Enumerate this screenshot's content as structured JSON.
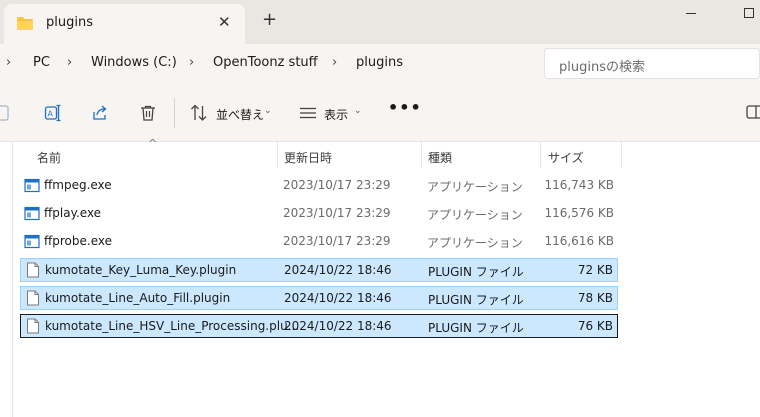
{
  "tab": {
    "title": "plugins",
    "close": "✕",
    "new_tab": "+"
  },
  "breadcrumb": {
    "items": [
      "PC",
      "Windows (C:)",
      "OpenToonz stuff",
      "plugins"
    ]
  },
  "search": {
    "placeholder": "pluginsの検索"
  },
  "toolbar": {
    "sort_label": "並べ替え",
    "view_label": "表示",
    "more": "•••"
  },
  "columns": {
    "name": "名前",
    "date": "更新日時",
    "type": "種類",
    "size": "サイズ"
  },
  "files": [
    {
      "name": "ffmpeg.exe",
      "date": "2023/10/17 23:29",
      "type": "アプリケーション",
      "size": "116,743 KB",
      "kind": "exe",
      "state": "normal"
    },
    {
      "name": "ffplay.exe",
      "date": "2023/10/17 23:29",
      "type": "アプリケーション",
      "size": "116,576 KB",
      "kind": "exe",
      "state": "normal"
    },
    {
      "name": "ffprobe.exe",
      "date": "2023/10/17 23:29",
      "type": "アプリケーション",
      "size": "116,616 KB",
      "kind": "exe",
      "state": "normal"
    },
    {
      "name": "kumotate_Key_Luma_Key.plugin",
      "date": "2024/10/22 18:46",
      "type": "PLUGIN ファイル",
      "size": "72 KB",
      "kind": "file",
      "state": "selected"
    },
    {
      "name": "kumotate_Line_Auto_Fill.plugin",
      "date": "2024/10/22 18:46",
      "type": "PLUGIN ファイル",
      "size": "78 KB",
      "kind": "file",
      "state": "selected"
    },
    {
      "name": "kumotate_Line_HSV_Line_Processing.plu...",
      "date": "2024/10/22 18:46",
      "type": "PLUGIN ファイル",
      "size": "76 KB",
      "kind": "file",
      "state": "focused"
    }
  ],
  "colors": {
    "selection": "#cce8ff",
    "selection_border": "#99d1ff",
    "folder": "#f5c443",
    "exe_blue": "#1f6fc5"
  }
}
